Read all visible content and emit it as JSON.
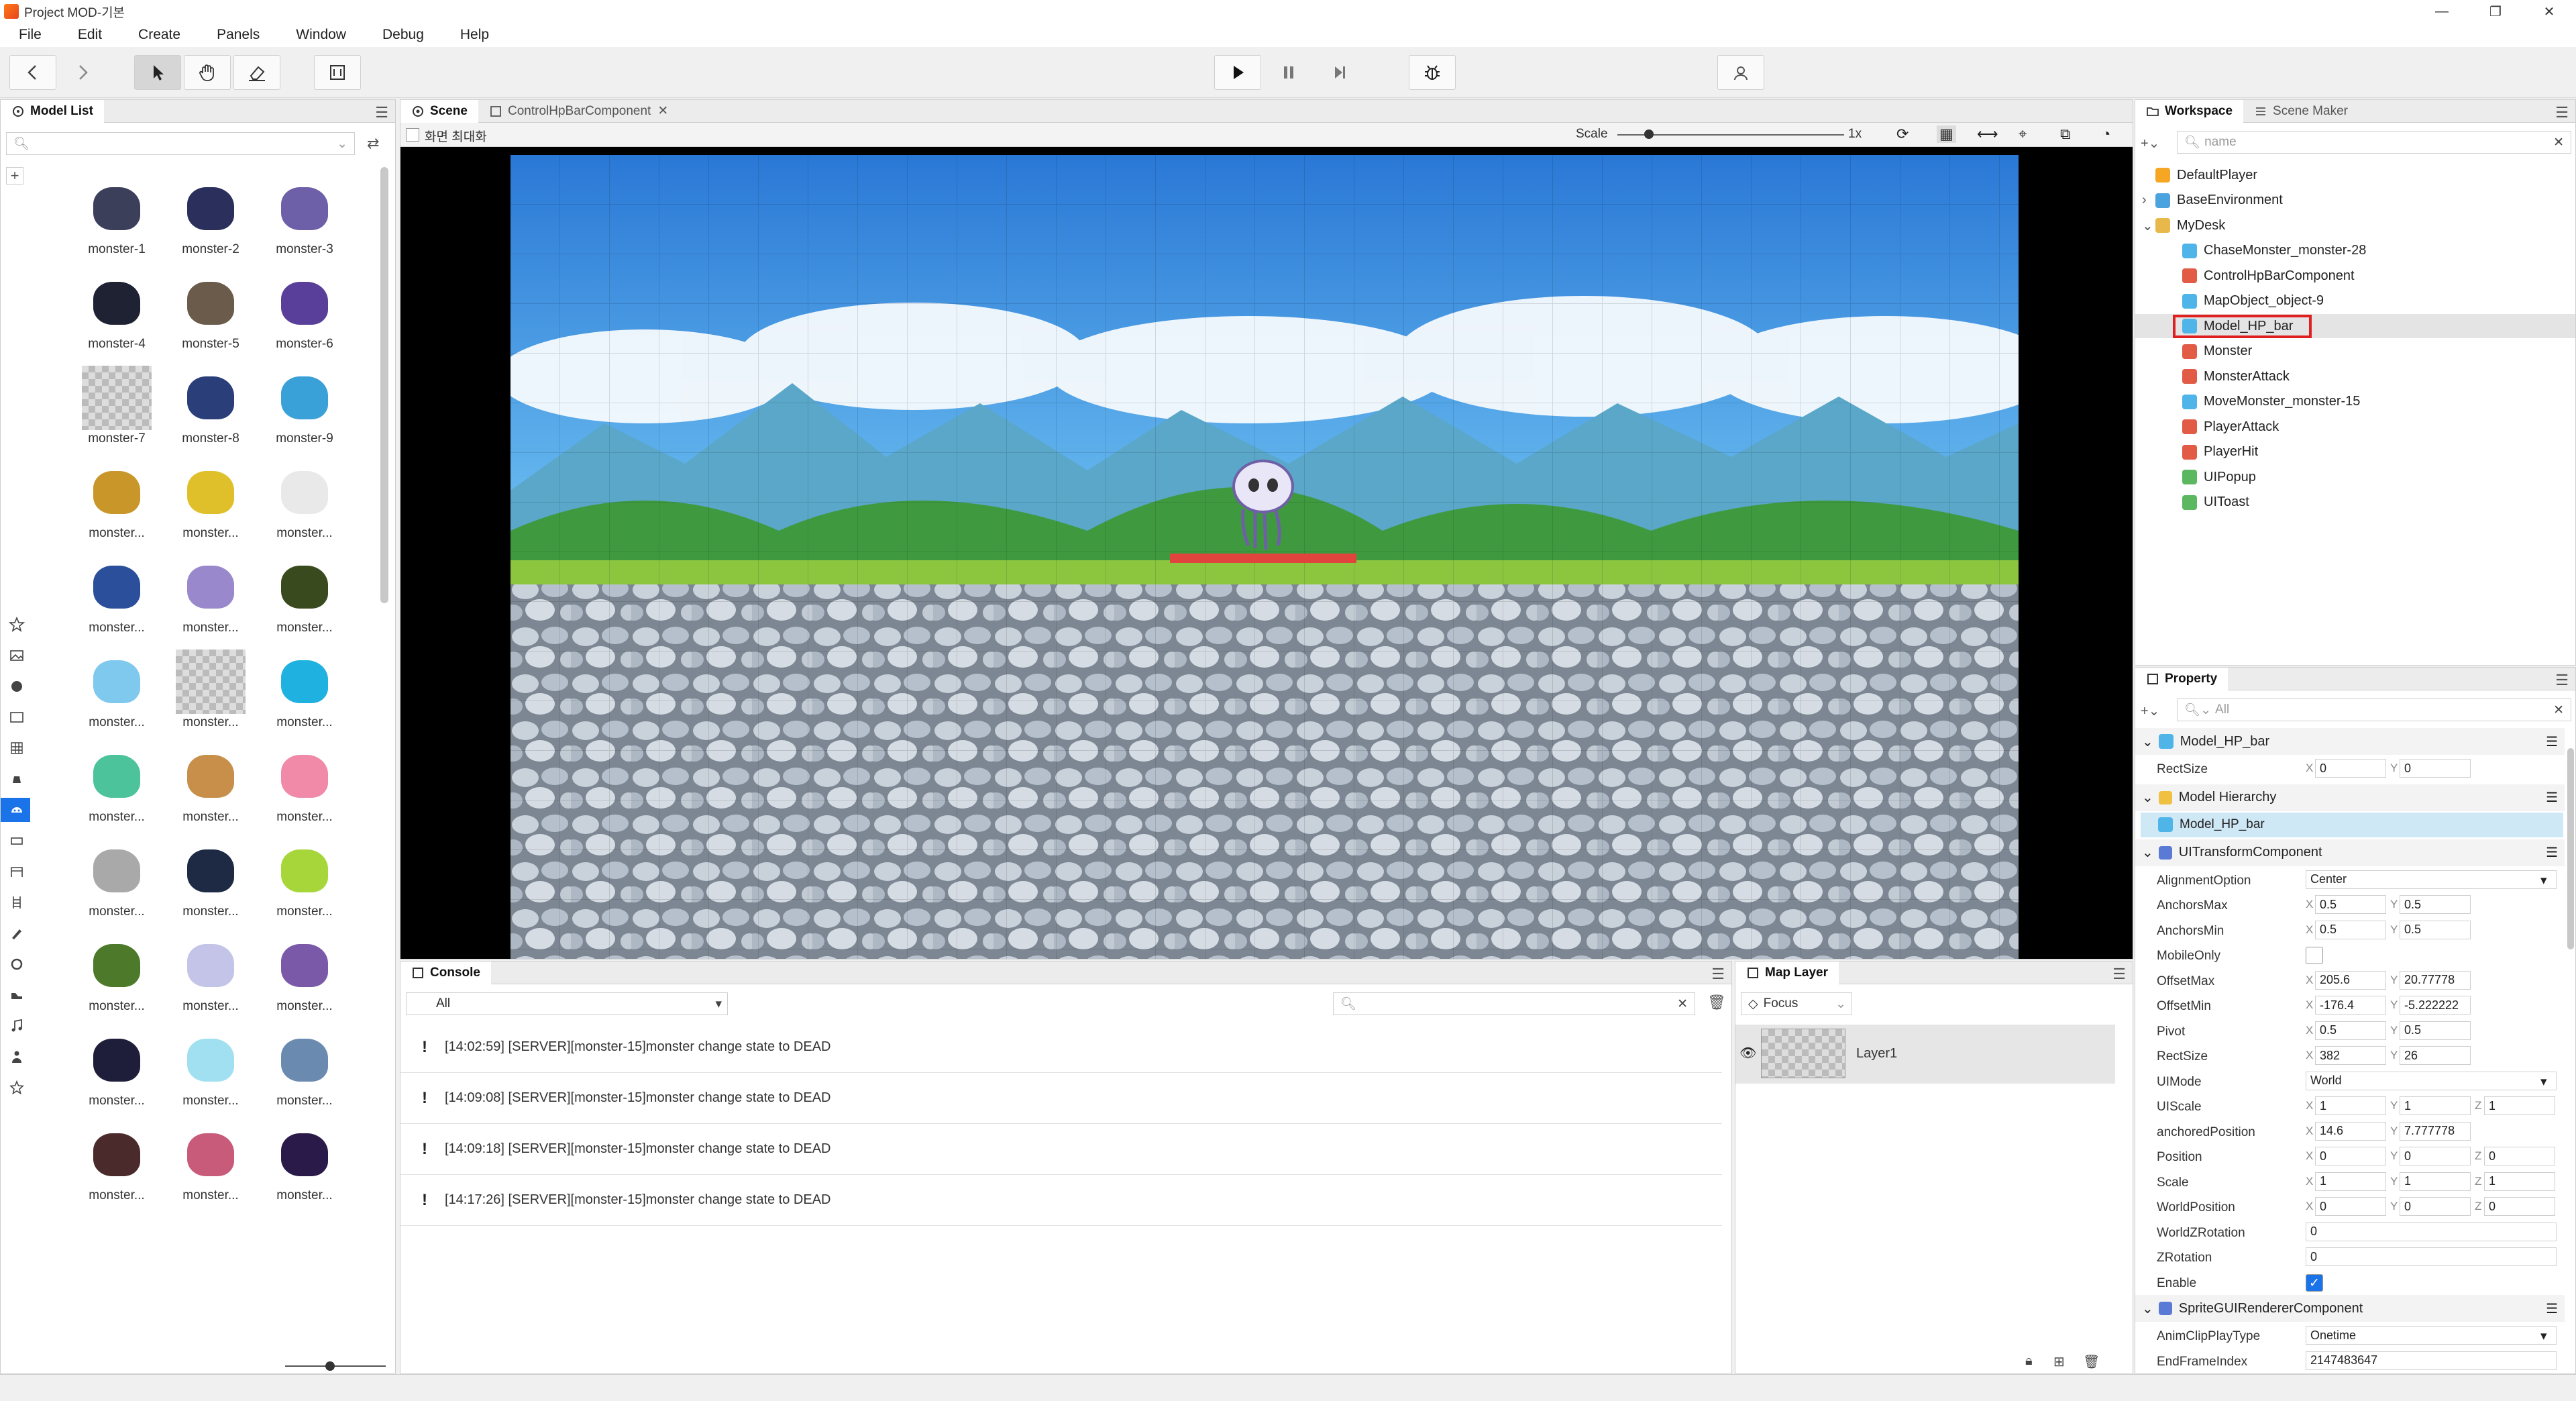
{
  "window": {
    "title": "Project MOD-기본",
    "controls": [
      "—",
      "❐",
      "✕"
    ]
  },
  "menu": [
    "File",
    "Edit",
    "Create",
    "Panels",
    "Window",
    "Debug",
    "Help"
  ],
  "toolbar": {
    "icons": [
      "back-arrow-icon",
      "forward-arrow-icon",
      "select-cursor-icon",
      "hand-pan-icon",
      "eraser-icon",
      "frame-icon",
      "play-icon",
      "pause-icon",
      "step-icon",
      "debug-bug-icon",
      "user-sync-icon"
    ]
  },
  "model_list": {
    "title": "Model List",
    "search_placeholder": "",
    "items": [
      "monster-1",
      "monster-2",
      "monster-3",
      "monster-4",
      "monster-5",
      "monster-6",
      "monster-7",
      "monster-8",
      "monster-9",
      "monster...",
      "monster...",
      "monster...",
      "monster...",
      "monster...",
      "monster...",
      "monster...",
      "monster...",
      "monster...",
      "monster...",
      "monster...",
      "monster...",
      "monster...",
      "monster...",
      "monster...",
      "monster...",
      "monster...",
      "monster...",
      "monster...",
      "monster...",
      "monster...",
      "monster...",
      "monster...",
      "monster..."
    ],
    "colors": [
      "#3b3f5a",
      "#2a2f5c",
      "#6d5fa8",
      "#1f2233",
      "#6b5b4a",
      "#5a3f9a",
      "checker",
      "#2a3e7a",
      "#3aa0d8",
      "#c9962a",
      "#e0c02a",
      "#e9e9e9",
      "#2b4f9a",
      "#9a88cc",
      "#3a4a1f",
      "#7fc8ee",
      "checker",
      "#1fb1e0",
      "#4cc39a",
      "#c78f4a",
      "#f08aa8",
      "#a9a9a9",
      "#1e2a44",
      "#a7d63a",
      "#4c7a2a",
      "#c4c4e8",
      "#7a5aa8",
      "#1e1e3a",
      "#a0e0f0",
      "#6a8ab0",
      "#4a2a2a",
      "#c85a7a",
      "#2a1a4a"
    ]
  },
  "scene": {
    "tabs": [
      "Scene",
      "ControlHpBarComponent"
    ],
    "maximize_label": "화면 최대화",
    "scale_label": "Scale",
    "scale_value": "1x",
    "scale_level": 0.14
  },
  "console": {
    "title": "Console",
    "filter_value": "All",
    "search_value": "",
    "rows": [
      {
        "icon": "!",
        "text": "[14:02:59] [SERVER][monster-15]monster change state to DEAD"
      },
      {
        "icon": "!",
        "text": "[14:09:08] [SERVER][monster-15]monster change state to DEAD"
      },
      {
        "icon": "!",
        "text": "[14:09:18] [SERVER][monster-15]monster change state to DEAD"
      },
      {
        "icon": "!",
        "text": "[14:17:26] [SERVER][monster-15]monster change state to DEAD"
      }
    ]
  },
  "map_layer": {
    "title": "Map Layer",
    "focus_label": "Focus",
    "layers": [
      "Layer1"
    ]
  },
  "workspace": {
    "tabs": [
      "Workspace",
      "Scene Maker"
    ],
    "search_placeholder": "name",
    "tree": [
      {
        "label": "DefaultPlayer",
        "icon": "player",
        "depth": 0,
        "arrow": ""
      },
      {
        "label": "BaseEnvironment",
        "icon": "env",
        "depth": 0,
        "arrow": "›"
      },
      {
        "label": "MyDesk",
        "icon": "folder",
        "depth": 0,
        "arrow": "⌄"
      },
      {
        "label": "ChaseMonster_monster-28",
        "icon": "model",
        "depth": 1,
        "arrow": ""
      },
      {
        "label": "ControlHpBarComponent",
        "icon": "script",
        "depth": 1,
        "arrow": ""
      },
      {
        "label": "MapObject_object-9",
        "icon": "model",
        "depth": 1,
        "arrow": ""
      },
      {
        "label": "Model_HP_bar",
        "icon": "model",
        "depth": 1,
        "arrow": "",
        "selected": true
      },
      {
        "label": "Monster",
        "icon": "script",
        "depth": 1,
        "arrow": ""
      },
      {
        "label": "MonsterAttack",
        "icon": "script",
        "depth": 1,
        "arrow": ""
      },
      {
        "label": "MoveMonster_monster-15",
        "icon": "model",
        "depth": 1,
        "arrow": ""
      },
      {
        "label": "PlayerAttack",
        "icon": "script",
        "depth": 1,
        "arrow": ""
      },
      {
        "label": "PlayerHit",
        "icon": "script",
        "depth": 1,
        "arrow": ""
      },
      {
        "label": "UIPopup",
        "icon": "ui",
        "depth": 1,
        "arrow": ""
      },
      {
        "label": "UIToast",
        "icon": "ui",
        "depth": 1,
        "arrow": ""
      }
    ]
  },
  "property": {
    "title": "Property",
    "search_placeholder": "All",
    "model_name": "Model_HP_bar",
    "model_rectsize": {
      "label": "RectSize",
      "x": "0",
      "y": "0"
    },
    "hierarchy_title": "Model Hierarchy",
    "hierarchy_item": "Model_HP_bar",
    "ui_transform_title": "UITransformComponent",
    "rows": [
      {
        "label": "AlignmentOption",
        "kind": "select",
        "value": "Center"
      },
      {
        "label": "AnchorsMax",
        "kind": "xy",
        "x": "0.5",
        "y": "0.5"
      },
      {
        "label": "AnchorsMin",
        "kind": "xy",
        "x": "0.5",
        "y": "0.5"
      },
      {
        "label": "MobileOnly",
        "kind": "check",
        "checked": false
      },
      {
        "label": "OffsetMax",
        "kind": "xy",
        "x": "205.6",
        "y": "20.77778"
      },
      {
        "label": "OffsetMin",
        "kind": "xy",
        "x": "-176.4",
        "y": "-5.222222"
      },
      {
        "label": "Pivot",
        "kind": "xy",
        "x": "0.5",
        "y": "0.5"
      },
      {
        "label": "RectSize",
        "kind": "xy",
        "x": "382",
        "y": "26"
      },
      {
        "label": "UIMode",
        "kind": "select",
        "value": "World"
      },
      {
        "label": "UIScale",
        "kind": "xyz",
        "x": "1",
        "y": "1",
        "z": "1"
      },
      {
        "label": "anchoredPosition",
        "kind": "xy",
        "x": "14.6",
        "y": "7.777778"
      },
      {
        "label": "Position",
        "kind": "xyz",
        "x": "0",
        "y": "0",
        "z": "0"
      },
      {
        "label": "Scale",
        "kind": "xyz",
        "x": "1",
        "y": "1",
        "z": "1"
      },
      {
        "label": "WorldPosition",
        "kind": "xyz",
        "x": "0",
        "y": "0",
        "z": "0"
      },
      {
        "label": "WorldZRotation",
        "kind": "text",
        "value": "0"
      },
      {
        "label": "ZRotation",
        "kind": "text",
        "value": "0"
      },
      {
        "label": "Enable",
        "kind": "check",
        "checked": true
      }
    ],
    "sprite_title": "SpriteGUIRendererComponent",
    "sprite_rows": [
      {
        "label": "AnimClipPlayType",
        "kind": "select",
        "value": "Onetime"
      },
      {
        "label": "EndFrameIndex",
        "kind": "text",
        "value": "2147483647"
      }
    ],
    "axis": {
      "x": "X",
      "y": "Y",
      "z": "Z"
    }
  },
  "colors": {
    "accent": "#1a73e8",
    "selection_box": "#e02020",
    "hp_bar": "#e0443c"
  }
}
